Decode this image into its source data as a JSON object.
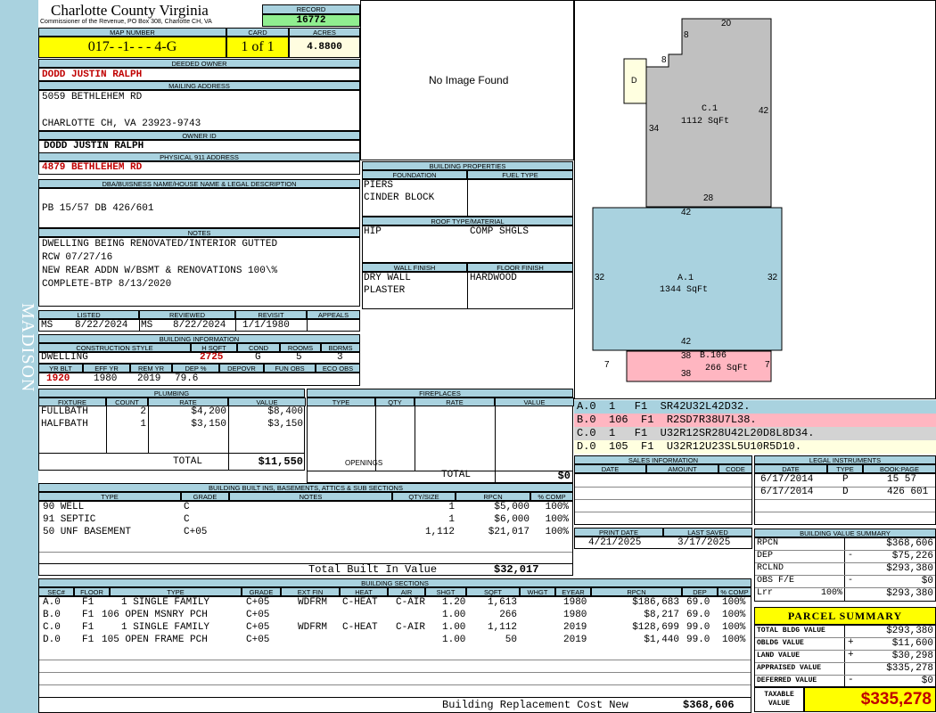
{
  "county": "Charlotte County Virginia",
  "commissioner": "Commissioner of the Revenue, PO Box 308, Charlotte CH, VA",
  "side_label": "MADISON",
  "record": {
    "label": "RECORD",
    "value": "16772"
  },
  "map": {
    "label": "MAP NUMBER",
    "value": "017- -1- - - 4-G",
    "card_label": "CARD",
    "card_value": "1 of 1",
    "acres_label": "ACRES",
    "acres_value": "4.8800"
  },
  "owner": {
    "label": "DEEDED OWNER",
    "value": "DODD JUSTIN RALPH",
    "mail_label": "MAILING ADDRESS",
    "mail1": "5059 BETHLEHEM RD",
    "mail2": "CHARLOTTE CH, VA 23923-9743",
    "id_label": "OWNER ID",
    "id_value": "DODD JUSTIN RALPH",
    "phys_label": "PHYSICAL 911 ADDRESS",
    "phys_value": "4879 BETHLEHEM RD"
  },
  "dba": {
    "label": "DBA/BUISNESS NAME/HOUSE NAME & LEGAL DESCRIPTION",
    "value": "PB 15/57 DB 426/601"
  },
  "notes": {
    "label": "NOTES",
    "lines": [
      "DWELLING BEING RENOVATED/INTERIOR GUTTED",
      "RCW 07/27/16",
      "NEW REAR ADDN W/BSMT & RENOVATIONS 100\\%",
      "COMPLETE-BTP 8/13/2020"
    ]
  },
  "dates": {
    "listed_label": "LISTED",
    "listed_by": "MS",
    "listed": "8/22/2024",
    "reviewed_label": "REVIEWED",
    "reviewed_by": "MS",
    "reviewed": "8/22/2024",
    "revisit_label": "REVISIT",
    "revisit": "1/1/1980",
    "appeals_label": "APPEALS",
    "appeals": ""
  },
  "building_info": {
    "label": "BUILDING INFORMATION",
    "h_cs": "CONSTRUCTION STYLE",
    "h_hsqft": "H SQFT",
    "h_cond": "COND",
    "h_rooms": "ROOMS",
    "h_bdrms": "BDRMS",
    "cs": "DWELLING",
    "hsqft": "2725",
    "cond": "G",
    "rooms": "5",
    "bdrms": "3",
    "h_yrblt": "YR BLT",
    "h_effyr": "EFF YR",
    "h_remyr": "REM YR",
    "h_dep": "DEP %",
    "h_depovr": "DEPOVR",
    "h_funobs": "FUN OBS",
    "h_ecoobs": "ECO OBS",
    "yrblt": "1920",
    "effyr": "1980",
    "remyr": "2019",
    "dep": "79.6",
    "depovr": "",
    "funobs": "",
    "ecoobs": ""
  },
  "plumbing": {
    "label": "PLUMBING",
    "h": [
      "FIXTURE",
      "COUNT",
      "RATE",
      "VALUE"
    ],
    "rows": [
      [
        "FULLBATH",
        "2",
        "$4,200",
        "$8,400"
      ],
      [
        "HALFBATH",
        "1",
        "$3,150",
        "$3,150"
      ],
      [
        "",
        "",
        "",
        ""
      ],
      [
        "",
        "",
        "",
        ""
      ]
    ],
    "total_label": "TOTAL",
    "total": "$11,550"
  },
  "fireplaces": {
    "label": "FIREPLACES",
    "h": [
      "TYPE",
      "QTY",
      "RATE",
      "VALUE"
    ],
    "openings_label": "OPENINGS",
    "total_label": "TOTAL",
    "total": "$0"
  },
  "photo": {
    "text": "No Image Found"
  },
  "bprops": {
    "label": "BUILDING PROPERTIES",
    "foundation_label": "FOUNDATION",
    "fuel_label": "FUEL TYPE",
    "foundation1": "PIERS",
    "foundation2": "CINDER BLOCK",
    "roof_label": "ROOF TYPE/MATERIAL",
    "roof_type": "HIP",
    "roof_mat": "COMP SHGLS",
    "wall_label": "WALL FINISH",
    "floor_label": "FLOOR FINISH",
    "wall1": "DRY WALL",
    "wall2": "PLASTER",
    "floor1": "HARDWOOD"
  },
  "sketch": {
    "c_label": "C.1",
    "c_area": "1112 SqFt",
    "a_label": "A.1",
    "a_area": "1344 SqFt",
    "b_label": "B.106",
    "b_area": "266 SqFt",
    "d_label": "D",
    "d20": "20",
    "d8a": "8",
    "d8b": "8",
    "d42r": "42",
    "d34": "34",
    "d28": "28",
    "a42t": "42",
    "a32l": "32",
    "a32r": "32",
    "a42b": "42",
    "b38t": "38",
    "b38b": "38",
    "b7l": "7",
    "b7r": "7"
  },
  "vectors": [
    {
      "text": "A.0  1   F1  SR42U32L42D32.",
      "color": "#a9d2df"
    },
    {
      "text": "B.0  106  F1  R2SD7R38U7L38.",
      "color": "#ffb6c1"
    },
    {
      "text": "C.0  1   F1  U32R12SR28U42L20D8L8D34.",
      "color": "#d3d3d3"
    },
    {
      "text": "D.0  105  F1  U32R12U23SL5U10R5D10.",
      "color": "#ffffe0"
    }
  ],
  "sales": {
    "label": "SALES INFORMATION",
    "h": [
      "DATE",
      "AMOUNT",
      "CODE"
    ]
  },
  "legal": {
    "label": "LEGAL INSTRUMENTS",
    "h": [
      "DATE",
      "TYPE",
      "BOOK:PAGE"
    ],
    "rows": [
      [
        "6/17/2014",
        "P",
        "15 57"
      ],
      [
        "6/17/2014",
        "D",
        "426 601"
      ]
    ]
  },
  "print": {
    "print_label": "PRINT DATE",
    "print_date": "4/21/2025",
    "saved_label": "LAST SAVED",
    "saved_date": "3/17/2025"
  },
  "bvs": {
    "label": "BUILDING VALUE SUMMARY",
    "rows": [
      [
        "RPCN",
        "",
        "$368,606"
      ],
      [
        "DEP",
        "-",
        "$75,226"
      ],
      [
        "RCLND",
        "",
        "$293,380"
      ],
      [
        "OBS F/E",
        "-",
        "$0"
      ],
      [
        "Lrr",
        "100%",
        "$293,380"
      ]
    ]
  },
  "parcel": {
    "label": "PARCEL SUMMARY",
    "rows": [
      [
        "TOTAL BLDG VALUE",
        "",
        "$293,380"
      ],
      [
        "OBLDG VALUE",
        "+",
        "$11,600"
      ],
      [
        "LAND VALUE",
        "+",
        "$30,298"
      ],
      [
        "APPRAISED VALUE",
        "",
        "$335,278"
      ],
      [
        "DEFERRED VALUE",
        "-",
        "$0"
      ]
    ],
    "taxable_label1": "TAXABLE",
    "taxable_label2": "VALUE",
    "taxable": "$335,278"
  },
  "builtins": {
    "label": "BUILDING BUILT INS, BASEMENTS, ATTICS & SUB SECTIONS",
    "h": [
      "TYPE",
      "GRADE",
      "NOTES",
      "QTY/SIZE",
      "RPCN",
      "% COMP"
    ],
    "rows": [
      [
        "90 WELL",
        "C",
        "",
        "1",
        "$5,000",
        "100%"
      ],
      [
        "91 SEPTIC",
        "C",
        "",
        "1",
        "$6,000",
        "100%"
      ],
      [
        "50 UNF BASEMENT",
        "C+05",
        "",
        "1,112",
        "$21,017",
        "100%"
      ]
    ],
    "total_label": "Total Built In Value",
    "total": "$32,017"
  },
  "sections": {
    "label": "BUILDING SECTIONS",
    "h": [
      "SEC#",
      "FLOOR",
      "TYPE",
      "GRADE",
      "EXT FIN",
      "HEAT",
      "AIR",
      "SHGT",
      "SQFT",
      "WHGT",
      "EYEAR",
      "RPCN",
      "DEP",
      "% COMP"
    ],
    "rows": [
      [
        "A.0",
        "F1",
        "1 SINGLE FAMILY",
        "C+05",
        "WDFRM",
        "C-HEAT",
        "C-AIR",
        "1.20",
        "1,613",
        "",
        "1980",
        "$186,683",
        "69.0",
        "100%"
      ],
      [
        "B.0",
        "F1",
        "106 OPEN MSNRY PCH",
        "C+05",
        "",
        "",
        "",
        "1.00",
        "266",
        "",
        "1980",
        "$8,217",
        "69.0",
        "100%"
      ],
      [
        "C.0",
        "F1",
        "1 SINGLE FAMILY",
        "C+05",
        "WDFRM",
        "C-HEAT",
        "C-AIR",
        "1.00",
        "1,112",
        "",
        "2019",
        "$128,699",
        "99.0",
        "100%"
      ],
      [
        "D.0",
        "F1",
        "105 OPEN FRAME PCH",
        "C+05",
        "",
        "",
        "",
        "1.00",
        "50",
        "",
        "2019",
        "$1,440",
        "99.0",
        "100%"
      ]
    ],
    "total_label": "Building Replacement Cost New",
    "total": "$368,606"
  }
}
